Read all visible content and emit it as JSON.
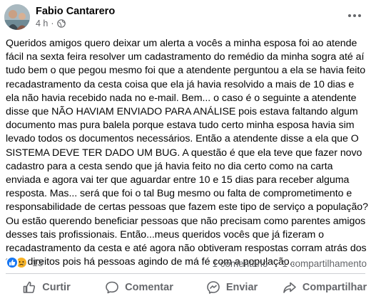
{
  "post": {
    "author": "Fabio Cantarero",
    "time": "4 h",
    "privacy_icon": "globe-icon",
    "more_icon": "more-options-icon",
    "text": "Queridos amigos quero deixar um alerta a vocês a minha esposa foi ao atende fácil na sexta feira resolver um cadastramento do remédio da minha sogra até aí tudo bem o que pegou mesmo foi que a atendente perguntou a ela se havia feito recadastramento da cesta coisa que ela já havia resolvido a mais de 10 dias e ela não havia recebido nada no e-mail. Bem... o caso é o seguinte a atendente disse que NÃO HAVIAM ENVIADO PARA ANÁLISE pois estava faltando algum documento mas pura balela porque estava tudo certo minha esposa havia sim levado todos os documentos necessários. Então a atendente disse a ela que O SISTEMA DEVE TER DADO UM BUG. A questão é que ela teve que fazer novo cadastro para a cesta sendo que já havia feito no dia certo como na carta enviada e agora vai ter que aguardar entre 10 e 15 dias para receber alguma resposta. Mas... será que foi o tal Bug mesmo ou falta de comprometimento e responsabilidade de certas pessoas que fazem este tipo de serviço a população? Ou estão querendo beneficiar pessoas que não precisam como parentes amigos desses tais profissionais. Então...meus queridos vocês que já fizeram o recadastramento da cesta e até agora não obtiveram respostas corram atrás dos teus direitos pois há pessoas agindo de má fé com a população.."
  },
  "stats": {
    "reactions": [
      "like",
      "sad"
    ],
    "reaction_count": "13",
    "comments": "1 comentário",
    "shares": "1 compartilhamento"
  },
  "actions": [
    {
      "label": "Curtir",
      "icon": "like-icon"
    },
    {
      "label": "Comentar",
      "icon": "comment-icon"
    },
    {
      "label": "Enviar",
      "icon": "send-icon"
    },
    {
      "label": "Compartilhar",
      "icon": "share-icon"
    }
  ],
  "colors": {
    "text": "#050505",
    "secondary": "#65676b",
    "like": "#1877f2",
    "sad": "#f7b125",
    "divider": "#ced0d4"
  }
}
